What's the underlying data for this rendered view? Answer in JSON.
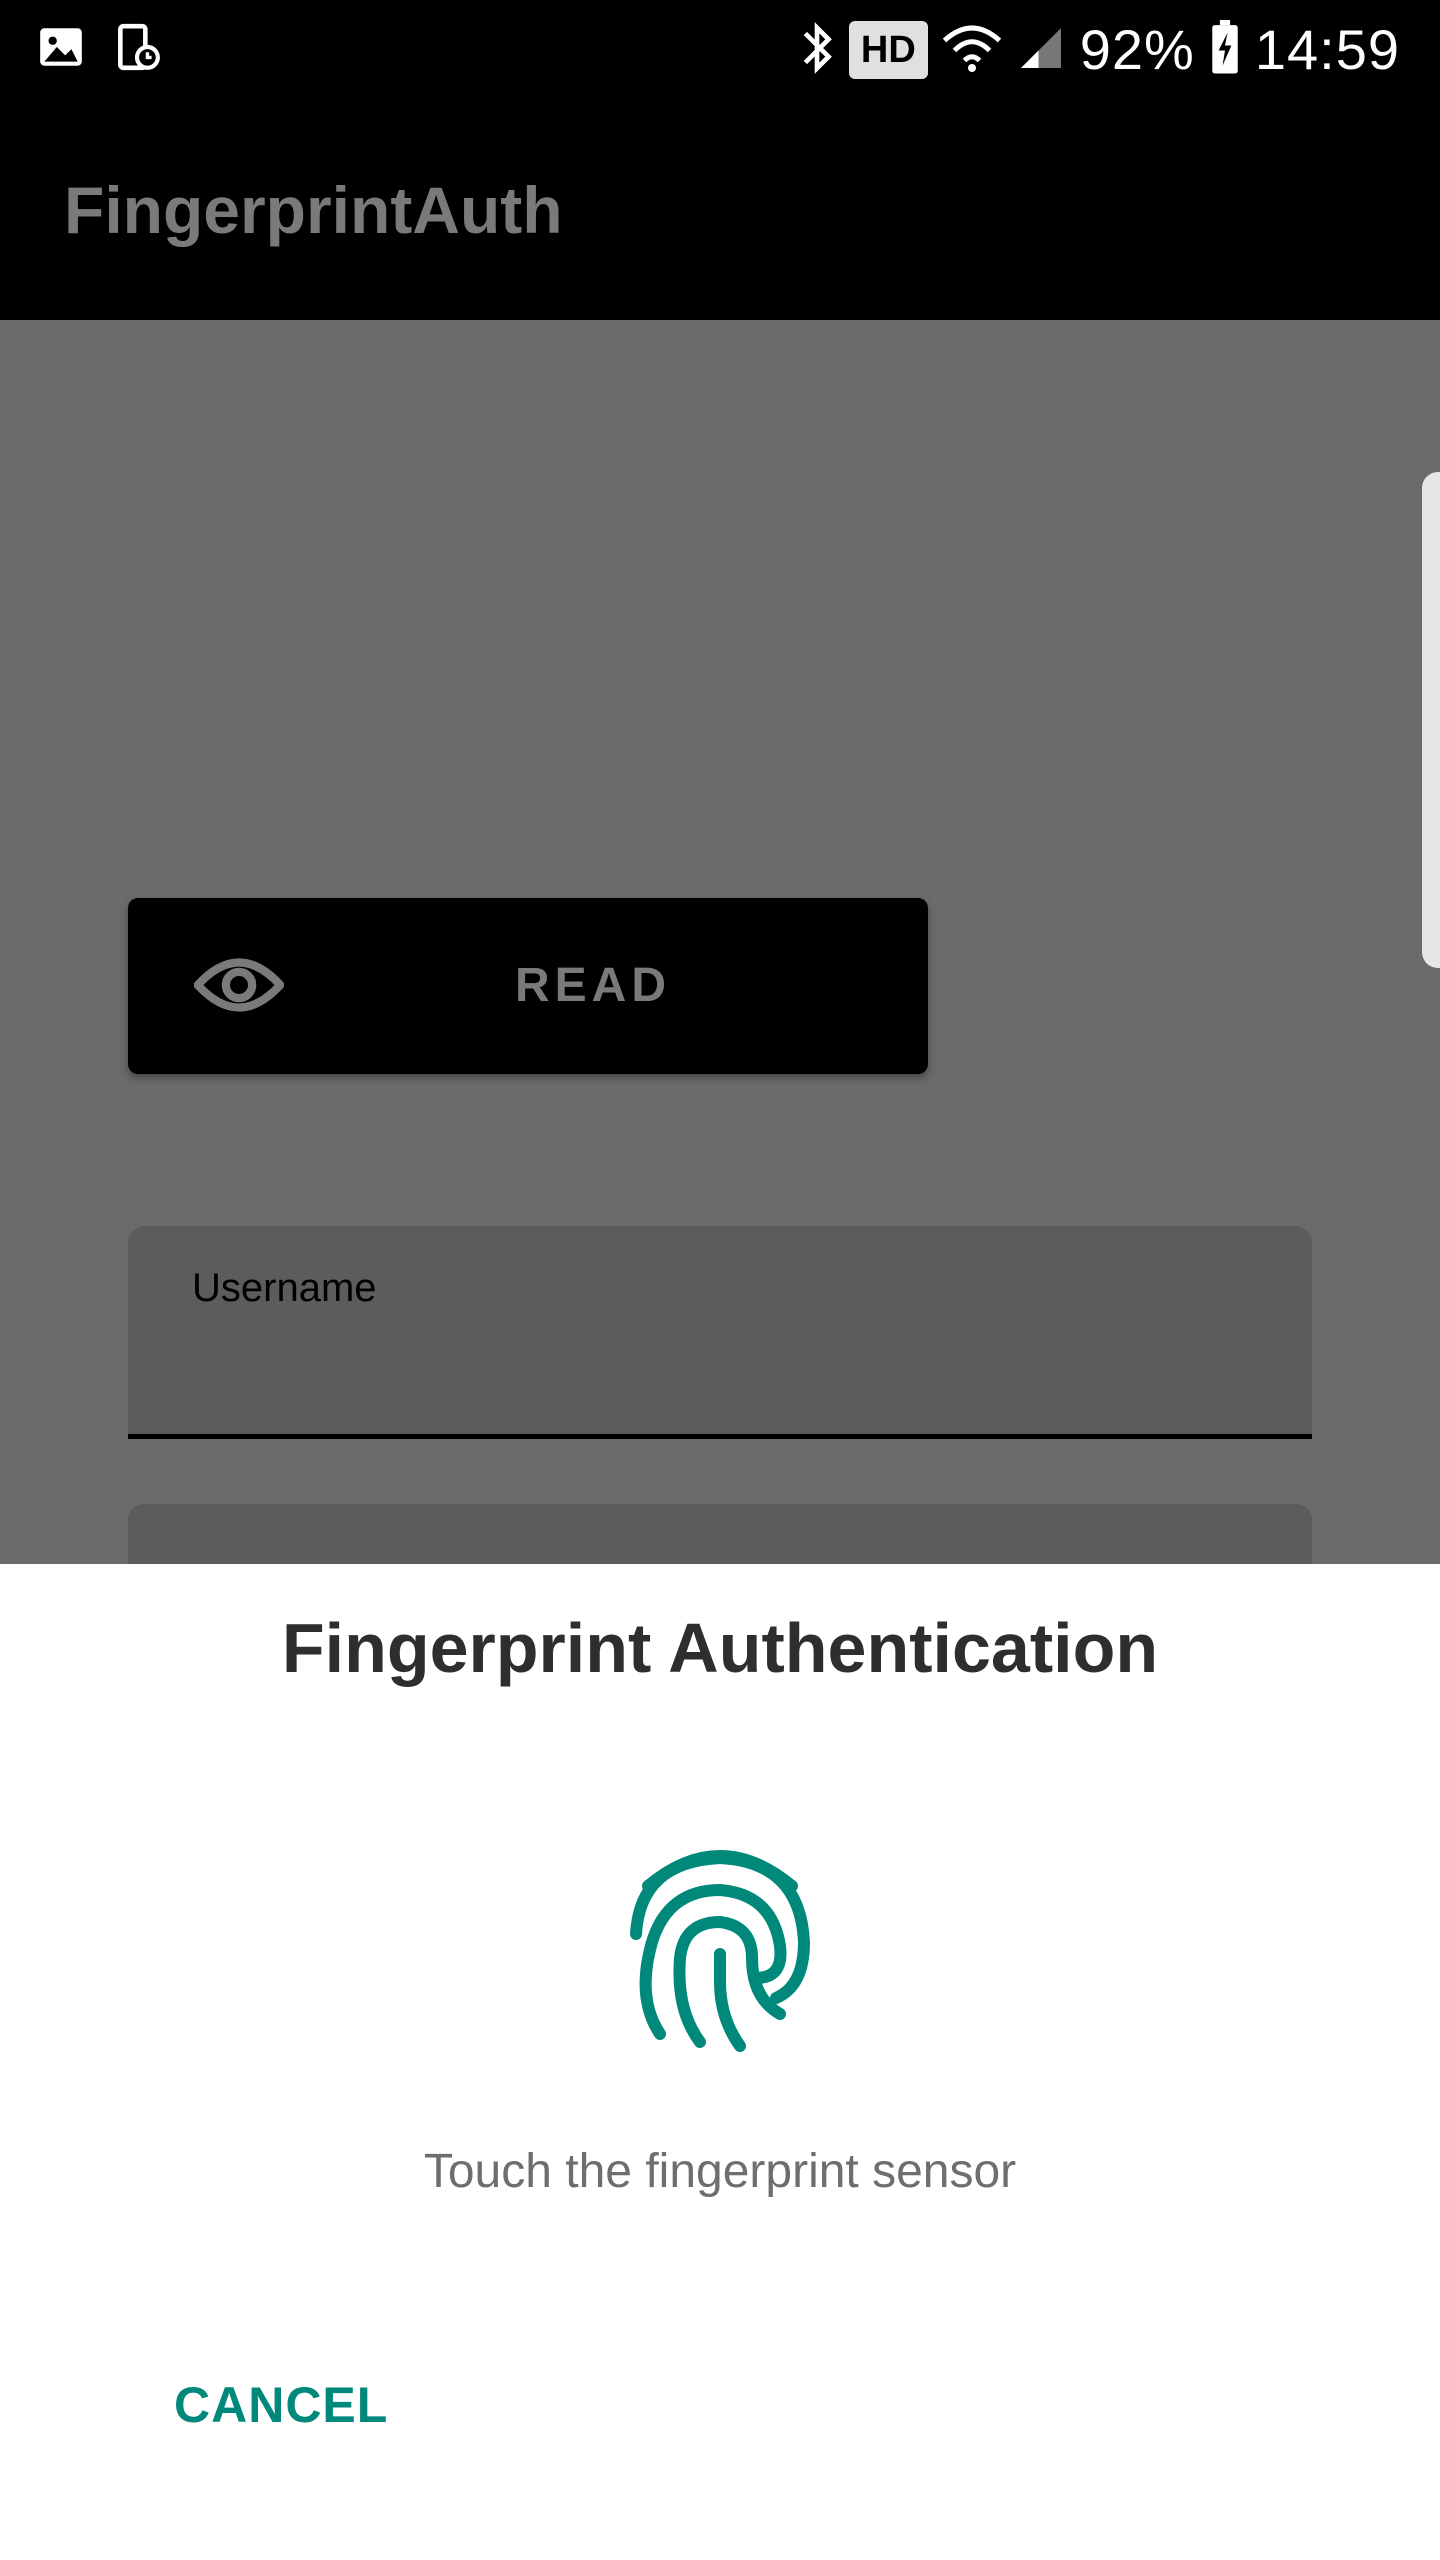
{
  "status_bar": {
    "hd": "HD",
    "battery": "92%",
    "time": "14:59",
    "icons": [
      "gallery-icon",
      "screenshot-icon",
      "bluetooth-icon",
      "wifi-icon",
      "signal-icon",
      "battery-icon"
    ]
  },
  "app_bar": {
    "title": "FingerprintAuth"
  },
  "main": {
    "read_button": {
      "label": "READ",
      "icon": "eye-icon"
    },
    "username_field": {
      "label": "Username"
    }
  },
  "dialog": {
    "title": "Fingerprint Authentication",
    "icon": "fingerprint-icon",
    "message": "Touch the fingerprint sensor",
    "cancel_label": "CANCEL",
    "accent_color": "#00897b"
  }
}
